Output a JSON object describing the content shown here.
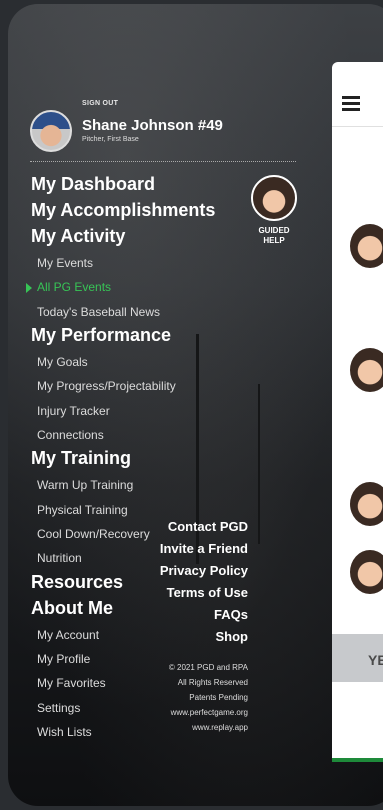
{
  "user": {
    "signout_label": "SIGN OUT",
    "name": "Shane Johnson #49",
    "role": "Pitcher, First Base"
  },
  "guided_help": {
    "label_line1": "GUIDED",
    "label_line2": "HELP"
  },
  "menu": {
    "my_dashboard": "My Dashboard",
    "my_accomplishments": "My Accomplishments",
    "my_activity": "My Activity",
    "my_events": "My Events",
    "all_pg_events": "All PG Events",
    "todays_news": "Today's Baseball News",
    "my_performance": "My Performance",
    "my_goals": "My Goals",
    "my_progress": "My Progress/Projectability",
    "injury_tracker": "Injury Tracker",
    "connections": "Connections",
    "my_training": "My Training",
    "warm_up": "Warm Up Training",
    "physical_training": "Physical  Training",
    "cool_down": "Cool Down/Recovery",
    "nutrition": "Nutrition",
    "resources": "Resources",
    "about_me": "About Me",
    "my_account": "My Account",
    "my_profile": "My Profile",
    "my_favorites": "My Favorites",
    "settings": "Settings",
    "wish_lists": "Wish Lists"
  },
  "secondary_links": {
    "contact": "Contact PGD",
    "invite": "Invite a Friend",
    "privacy": "Privacy Policy",
    "terms": "Terms of Use",
    "faqs": "FAQs",
    "shop": "Shop"
  },
  "legal": {
    "copyright": "© 2021 PGD and RPA",
    "rights": "All Rights Reserved",
    "patents": "Patents Pending",
    "url1": "www.perfectgame.org",
    "url2": "www.replay.app"
  },
  "panel": {
    "button_fragment": "YE"
  },
  "colors": {
    "accent_green": "#37c456",
    "panel_bg": "#ffffff",
    "menu_bg": "#1c1e21"
  },
  "active_item": "all_pg_events"
}
